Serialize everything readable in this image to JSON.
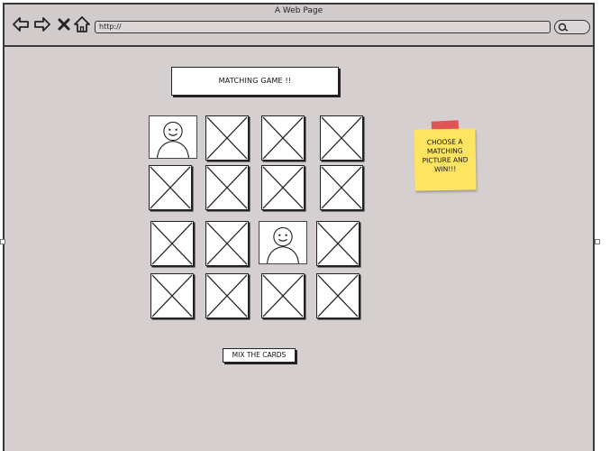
{
  "window": {
    "title": "A Web Page",
    "url": "http://"
  },
  "nav": {
    "back_icon": "arrow-left-icon",
    "forward_icon": "arrow-right-icon",
    "stop_icon": "close-icon",
    "home_icon": "home-icon",
    "search_icon": "search-icon"
  },
  "game": {
    "title": "MATCHING GAME !!",
    "mix_label": "MIX THE CARDS",
    "cards": [
      [
        "face",
        "hidden",
        "hidden",
        "hidden"
      ],
      [
        "hidden",
        "hidden",
        "hidden",
        "hidden"
      ],
      [
        "hidden",
        "hidden",
        "face",
        "hidden"
      ],
      [
        "hidden",
        "hidden",
        "hidden",
        "hidden"
      ]
    ]
  },
  "note": {
    "text": "CHOOSE A MATCHING PICTURE AND WIN!!!",
    "color": "#fde461",
    "tape_color": "#e24a4a"
  }
}
